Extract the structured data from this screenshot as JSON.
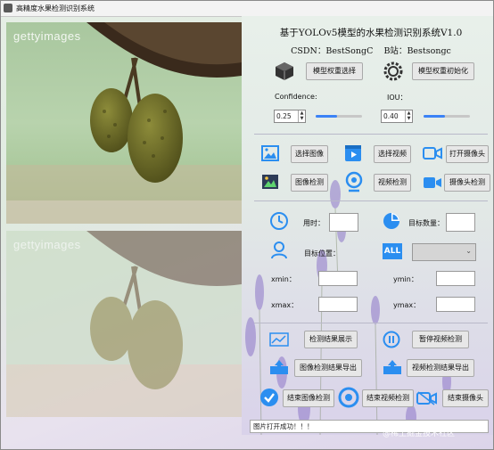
{
  "window": {
    "title": "高精度水果检测识别系统"
  },
  "images": {
    "watermark": "gettyimages"
  },
  "header": {
    "title": "基于YOLOv5模型的水果检测识别系统V1.0",
    "csdn_label": "CSDN：",
    "csdn_value": "BestSongC",
    "bilibili_label": "B站：",
    "bilibili_value": "Bestsongc"
  },
  "model": {
    "select_label": "模型权重选择",
    "init_label": "模型权重初始化"
  },
  "params": {
    "confidence_label": "Confidence:",
    "confidence_value": "0.25",
    "iou_label": "IOU：",
    "iou_value": "0.40"
  },
  "controls": {
    "select_image": "选择图像",
    "select_video": "选择视频",
    "open_camera": "打开摄像头",
    "image_detect": "图像检测",
    "video_detect": "视频检测",
    "camera_detect": "摄像头检测"
  },
  "results": {
    "time_label": "用时：",
    "count_label": "目标数量：",
    "position_label": "目标位置：",
    "xmin_label": "xmin：",
    "ymin_label": "ymin：",
    "xmax_label": "xmax：",
    "ymax_label": "ymax：",
    "all_icon_text": "ALL"
  },
  "actions": {
    "show_results": "检测结果展示",
    "pause_video": "暂停视频检测",
    "export_image": "图像检测结果导出",
    "export_video": "视频检测结果导出",
    "end_image": "结束图像检测",
    "end_video": "结束视频检测",
    "end_camera": "结束摄像头"
  },
  "status": {
    "message": "图片打开成功！！！"
  },
  "footer": {
    "watermark": "@稀土掘金技术社区"
  },
  "colors": {
    "accent": "#2b8ef0",
    "slider": "#3b82f6",
    "icon_dark": "#2d3b57"
  }
}
